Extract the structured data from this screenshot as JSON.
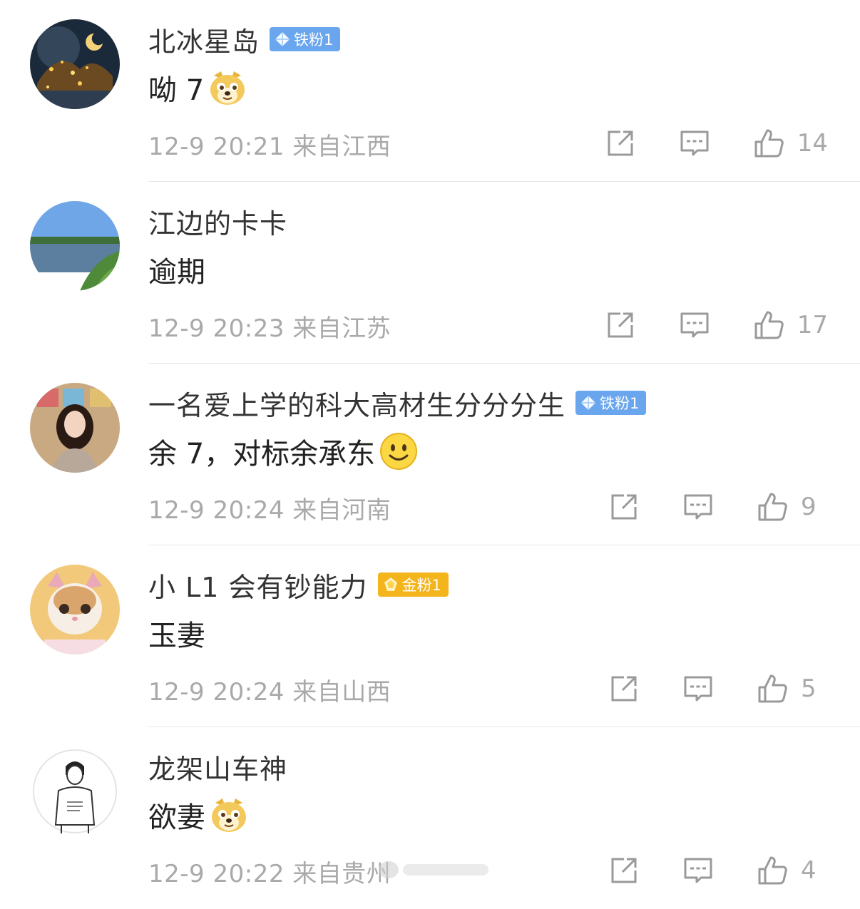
{
  "comments": [
    {
      "name": "北冰星岛",
      "badge": "铁粉1",
      "badge_type": "blue",
      "text": "呦 7",
      "emoji": "doge",
      "time": "12-9 20:21",
      "location": "来自江西",
      "likes": "14",
      "avatar": "night-sky-lake"
    },
    {
      "name": "江边的卡卡",
      "badge": "",
      "badge_type": "",
      "text": "逾期",
      "emoji": "",
      "time": "12-9 20:23",
      "location": "来自江苏",
      "likes": "17",
      "avatar": "riverside-landscape"
    },
    {
      "name": "一名爱上学的科大高材生分分分生",
      "badge": "铁粉1",
      "badge_type": "blue",
      "text": "余 7，对标余承东",
      "emoji": "smile",
      "time": "12-9 20:24",
      "location": "来自河南",
      "likes": "9",
      "avatar": "girl-portrait"
    },
    {
      "name": "小 L1 会有钞能力",
      "badge": "金粉1",
      "badge_type": "gold",
      "text": "玉妻",
      "emoji": "",
      "time": "12-9 20:24",
      "location": "来自山西",
      "likes": "5",
      "avatar": "cat-photo"
    },
    {
      "name": "龙架山车神",
      "badge": "",
      "badge_type": "",
      "text": "欲妻",
      "emoji": "doge",
      "time": "12-9 20:22",
      "location": "来自贵州",
      "likes": "4",
      "avatar": "sketch-man"
    }
  ],
  "icons": {
    "share": "share-icon",
    "comment": "comment-icon",
    "like": "like-icon"
  },
  "colors": {
    "name": "#333333",
    "meta": "#a9a9a9",
    "badge_blue": "#6aa6ee",
    "badge_gold": "#f3b41c",
    "divider": "#e6e6e6"
  }
}
